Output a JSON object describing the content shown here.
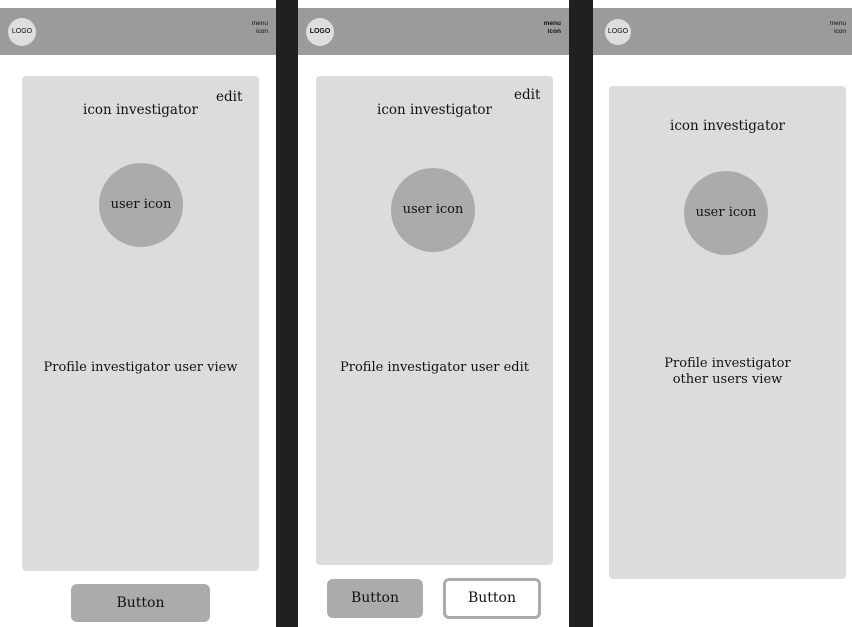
{
  "screens": [
    {
      "logo": "LOGO",
      "menu_line1": "menu",
      "menu_line2": "icon",
      "card_title": "icon investigator",
      "edit_label": "edit",
      "avatar_label": "user icon",
      "profile_line1": "Profile investigator user view",
      "button_label": "Button"
    },
    {
      "logo": "LOGO",
      "menu_line1": "menu",
      "menu_line2": "icon",
      "card_title": "icon investigator",
      "edit_label": "edit",
      "avatar_label": "user icon",
      "profile_line1": "Profile investigator user edit",
      "button_label": "Button",
      "button2_label": "Button"
    },
    {
      "logo": "LOGO",
      "menu_line1": "menu",
      "menu_line2": "icon",
      "card_title": "icon investigator",
      "avatar_label": "user icon",
      "profile_line1": "Profile investigator",
      "profile_line2": "other users view"
    }
  ],
  "colors": {
    "header": "#9b9b9b",
    "card": "#dcdcdc",
    "avatar": "#ababab",
    "separator": "#202020",
    "button": "#ababab"
  }
}
